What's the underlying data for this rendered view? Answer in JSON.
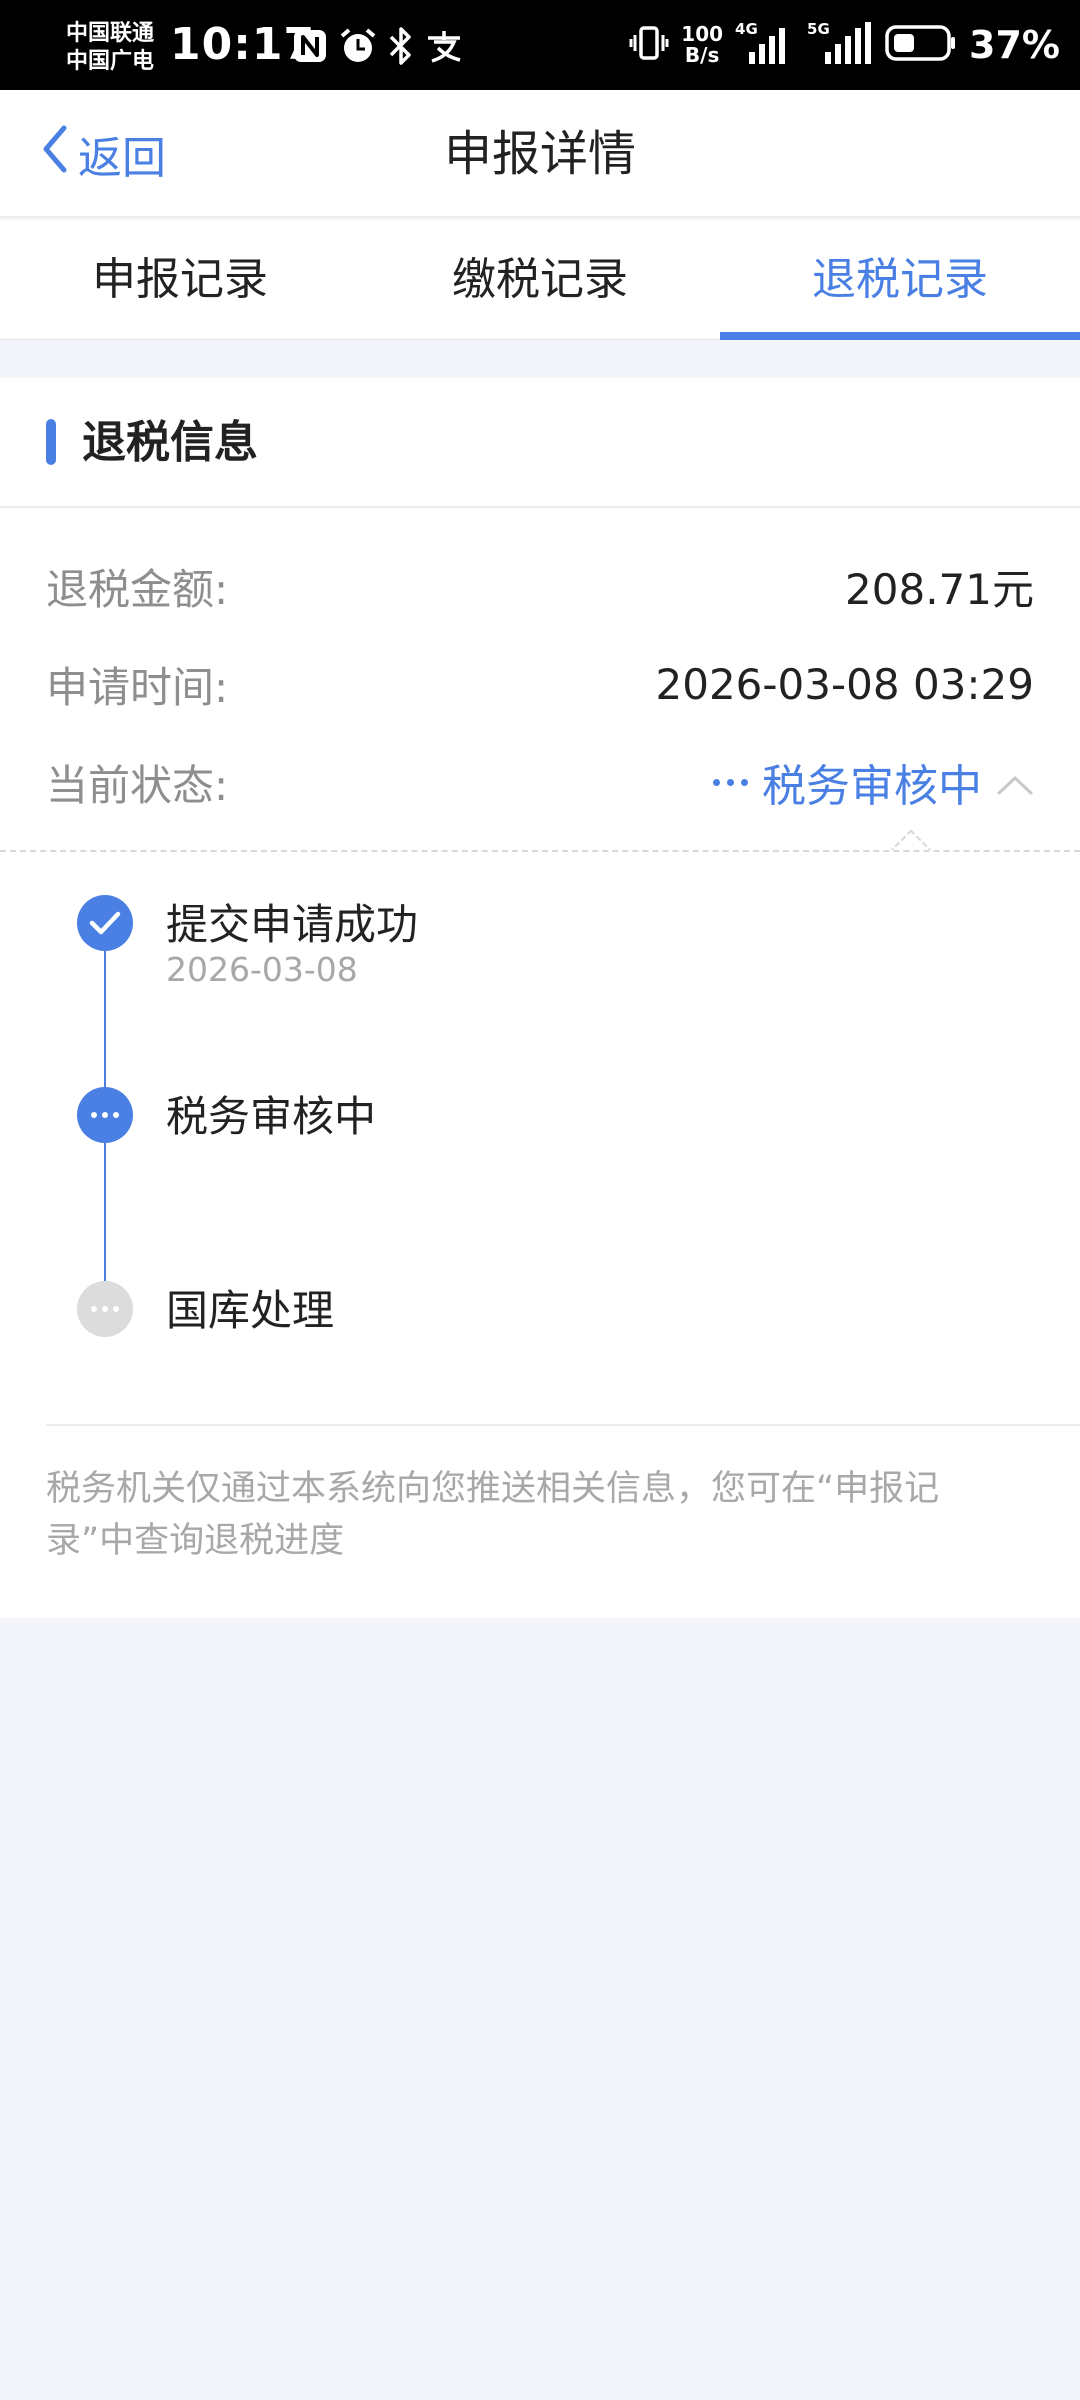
{
  "status_bar": {
    "carrier_1": "中国联通",
    "carrier_2": "中国广电",
    "time": "10:17",
    "net_speed_value": "100",
    "net_speed_unit": "B/s",
    "sig1_label": "4G",
    "sig2_label": "5G",
    "battery": "37%",
    "icons": [
      "nfc-icon",
      "alarm-icon",
      "bluetooth-icon",
      "alipay-icon",
      "vibrate-icon",
      "signal-4g-icon",
      "signal-5g-icon",
      "battery-icon"
    ]
  },
  "nav": {
    "back_label": "返回",
    "title": "申报详情"
  },
  "tabs": [
    {
      "label": "申报记录",
      "active": false
    },
    {
      "label": "缴税记录",
      "active": false
    },
    {
      "label": "退税记录",
      "active": true
    }
  ],
  "section": {
    "title": "退税信息"
  },
  "info": {
    "amount_label": "退税金额:",
    "amount_value": "208.71元",
    "time_label": "申请时间:",
    "time_value": "2026-03-08 03:29",
    "status_label": "当前状态:",
    "status_value": "税务审核中"
  },
  "timeline": [
    {
      "title": "提交申请成功",
      "date": "2026-03-08",
      "state": "done"
    },
    {
      "title": "税务审核中",
      "date": "",
      "state": "current"
    },
    {
      "title": "国库处理",
      "date": "",
      "state": "pending"
    }
  ],
  "footer_note": "税务机关仅通过本系统向您推送相关信息，您可在“申报记录”中查询退税进度",
  "colors": {
    "accent": "#4a7fe3",
    "background": "#f3f5fa",
    "muted_text": "#8e8e8e",
    "pending": "#dcdcdc"
  }
}
